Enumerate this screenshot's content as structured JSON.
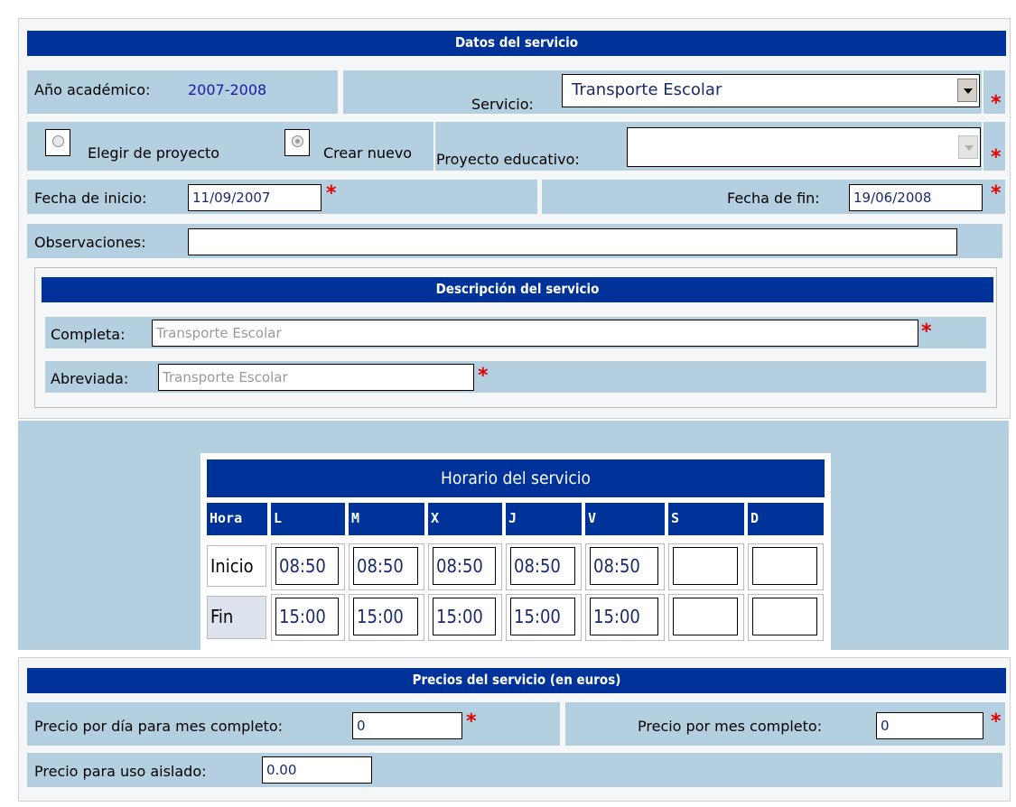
{
  "datos": {
    "header": "Datos del servicio",
    "ano_label": "Año académico:",
    "ano_value": "2007-2008",
    "servicio_label": "Servicio:",
    "servicio_value": "Transporte Escolar",
    "radio_elegir": "Elegir de proyecto",
    "radio_crear": "Crear nuevo",
    "proyecto_label": "Proyecto educativo:",
    "proyecto_value": "",
    "fecha_inicio_label": "Fecha de inicio:",
    "fecha_inicio_value": "11/09/2007",
    "fecha_fin_label": "Fecha de fin:",
    "fecha_fin_value": "19/06/2008",
    "observaciones_label": "Observaciones:",
    "observaciones_value": "",
    "required_mark": "*"
  },
  "descripcion": {
    "header": "Descripción del servicio",
    "completa_label": "Completa:",
    "completa_value": "Transporte Escolar",
    "abreviada_label": "Abreviada:",
    "abreviada_value": "Transporte Escolar"
  },
  "horario": {
    "title": "Horario del servicio",
    "columns": [
      "Hora",
      "L",
      "M",
      "X",
      "J",
      "V",
      "S",
      "D"
    ],
    "inicio_label": "Inicio",
    "fin_label": "Fin",
    "inicio": [
      "08:50",
      "08:50",
      "08:50",
      "08:50",
      "08:50",
      "",
      ""
    ],
    "fin": [
      "15:00",
      "15:00",
      "15:00",
      "15:00",
      "15:00",
      "",
      ""
    ]
  },
  "precios": {
    "header": "Precios del servicio (en euros)",
    "dia_label": "Precio por día para mes completo:",
    "dia_value": "0",
    "mes_label": "Precio por mes completo:",
    "mes_value": "0",
    "aislado_label": "Precio para uso aislado:",
    "aislado_value": "0.00"
  },
  "colors": {
    "header_blue": "#003399",
    "cell_blue": "#b4cfe0",
    "required_red": "#e00000"
  }
}
